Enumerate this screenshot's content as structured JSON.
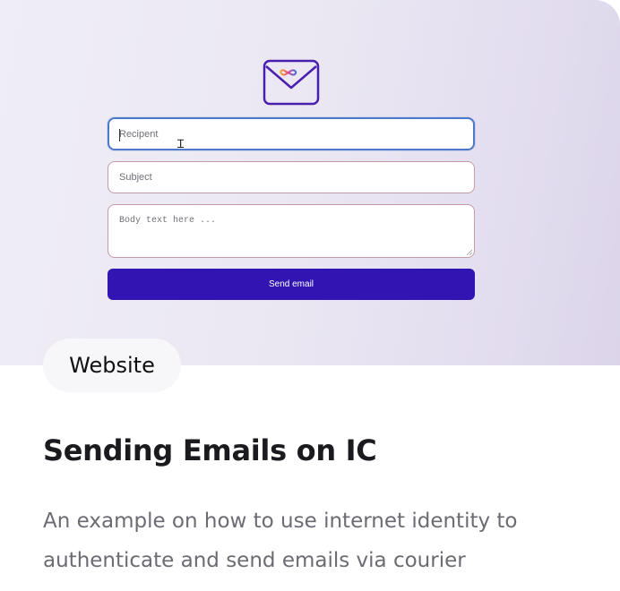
{
  "preview": {
    "logo_icon": "envelope-infinity-icon",
    "recipient_placeholder": "Recipent",
    "subject_placeholder": "Subject",
    "body_placeholder": "Body text here ...",
    "send_label": "Send email",
    "colors": {
      "button": "#3114b1",
      "focus_border": "#4c79c9",
      "field_border": "#c79aa6"
    }
  },
  "card": {
    "tag": "Website",
    "title": "Sending Emails on IC",
    "description": "An example on how to use internet identity to authenticate and send emails via courier"
  }
}
